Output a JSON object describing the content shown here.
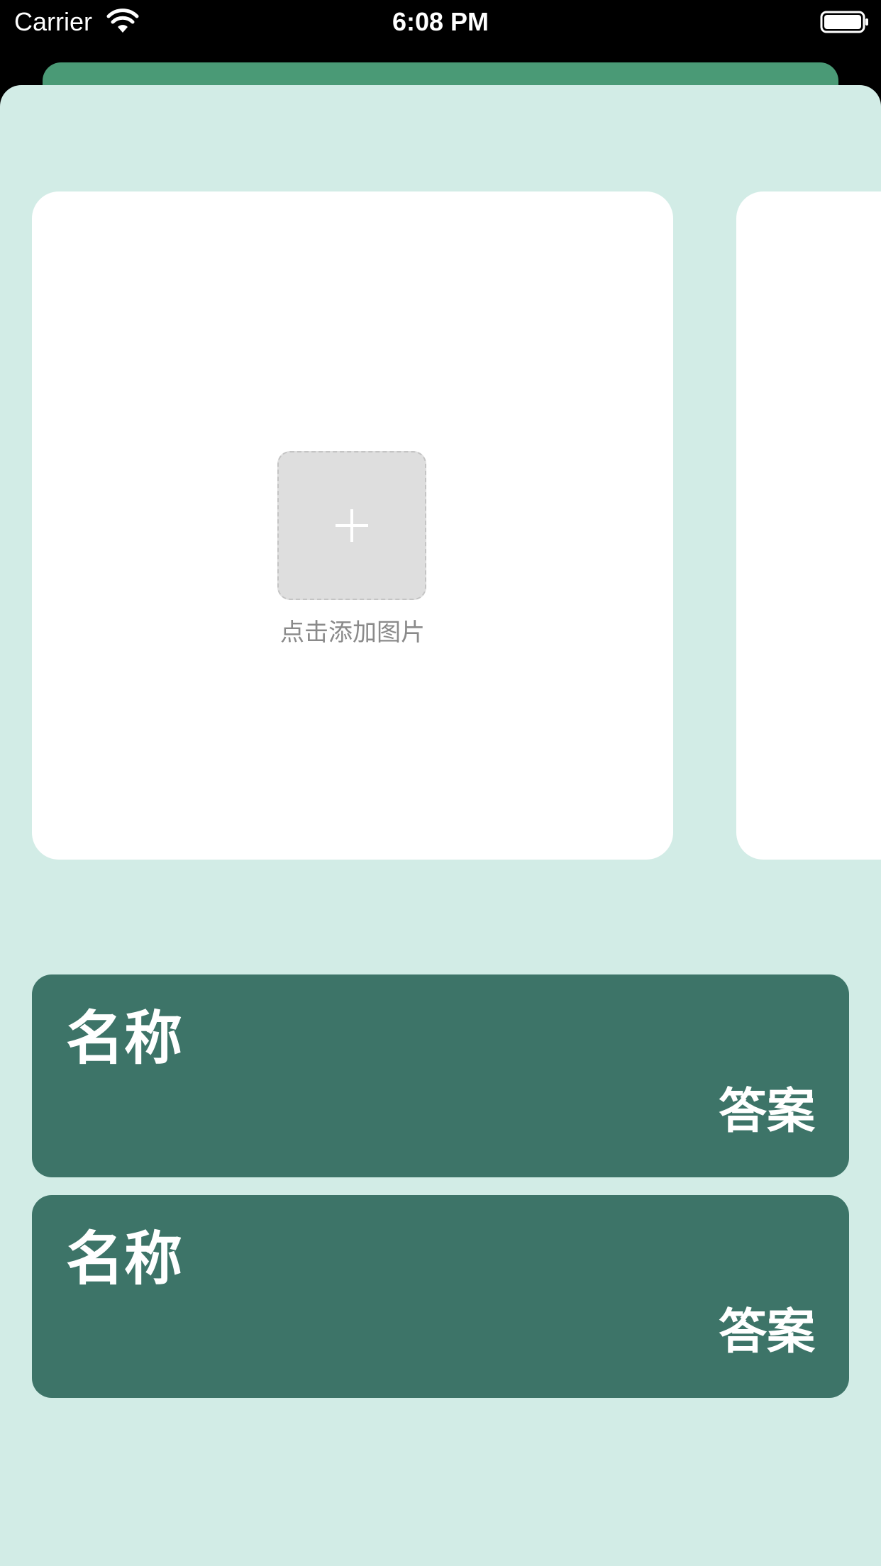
{
  "status_bar": {
    "carrier": "Carrier",
    "time": "6:08 PM"
  },
  "colors": {
    "sheet_background": "#d2ece6",
    "accent_green": "#4a9a76",
    "card_green": "#3d7468"
  },
  "image_picker": {
    "label": "点击添加图片",
    "icon": "plus-icon"
  },
  "answer_cards": [
    {
      "title": "名称",
      "answer": "答案"
    },
    {
      "title": "名称",
      "answer": "答案"
    }
  ]
}
